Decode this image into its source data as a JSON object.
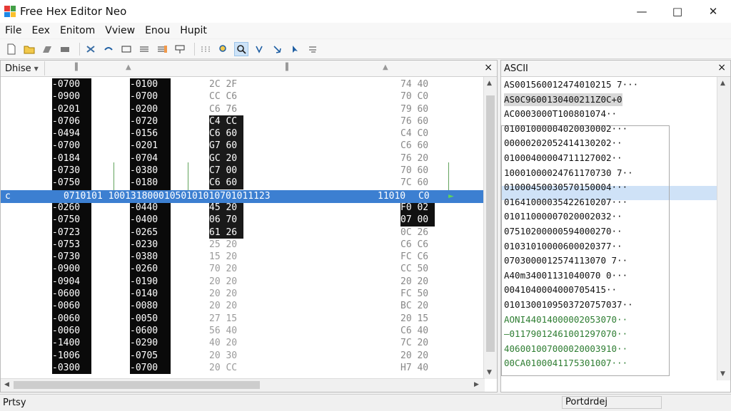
{
  "window": {
    "title": "Free Hex Editor Neo",
    "minimize": "—",
    "maximize": "□",
    "close": "✕"
  },
  "menu": [
    "File",
    "Eex",
    "Enitom",
    "Vview",
    "Enou",
    "Hupit"
  ],
  "toolbar_icons": [
    "new-file-icon",
    "open-folder-icon",
    "save-icon",
    "print-icon",
    "cut-icon",
    "undo-icon",
    "copy-icon",
    "paste-icon",
    "replace-icon",
    "edit-icon",
    "find-icon",
    "zoom-icon",
    "search-icon",
    "filter-icon",
    "bookmark-icon",
    "cursor-icon",
    "settings-icon"
  ],
  "left_pane": {
    "dropdown": "Dhise",
    "close": "×",
    "col_a": [
      "-0700",
      "-0900",
      "-0201",
      "-0706",
      "-0494",
      "-0700",
      "-0184",
      "-0730",
      "-0750",
      "C",
      "-0260",
      "-0750",
      "-0723",
      "-0753",
      "-0730",
      "-0900",
      "-0904",
      "-0600",
      "-0060",
      "-0060",
      "-0060",
      "-1400",
      "-1006",
      "-0300"
    ],
    "col_b": [
      "-0100",
      "-0700",
      "-0200",
      "-0720",
      "-0156",
      "-0201",
      "-0704",
      "-0380",
      "-0180",
      "",
      "-0440",
      "-0400",
      "-0265",
      "-0230",
      "-0380",
      "-0260",
      "-0190",
      "-0140",
      "-0080",
      "-0050",
      "-0600",
      "-0290",
      "-0705",
      "-0700"
    ],
    "col_c": [
      "2C 2F",
      "CC C6",
      "C6 76",
      "C4 CC",
      "C6 60",
      "G7 60",
      "GC 20",
      "C7 00",
      "C6 60",
      "",
      "45 20",
      "06 70",
      "61 26",
      "25 20",
      "15 20",
      "70 20",
      "20 20",
      "20 20",
      "20 20",
      "27 15",
      "56 40",
      "40 20",
      "20 30",
      "20 CC"
    ],
    "col_d": [
      "74 40",
      "70 C0",
      "79 60",
      "76 60",
      "C4 C0",
      "C6 60",
      "76 20",
      "70 60",
      "7C 60",
      "",
      "F0 02",
      "07 00",
      "0C 26",
      "C6 C6",
      "FC C6",
      "CC 50",
      "20 20",
      "FC 50",
      "BC 20",
      "20 15",
      "C6 40",
      "7C 20",
      "20 20",
      "H7 40"
    ],
    "selected_row": {
      "prefix": "c",
      "data": "0710101 10013180001050101010701011123",
      "tail": "11010",
      "tail2": "C0"
    }
  },
  "right_pane": {
    "title": "ASCII",
    "close": "×",
    "rows": [
      "AS001560012474010215 7···",
      "AS0C9600130400211Z0C+0",
      "AC0003000T100801074··",
      "01001000004020030002···",
      "00000202052414130202··",
      "01000400004711127002··",
      "10001000024761170730 7··",
      "01000450030570150004···",
      "01641000035422610207···",
      "01011000007020002032··",
      "07510200000594000270··",
      "01031010000600020377··",
      "0703000012574113070 7··",
      "A40m34001131040070 0···",
      "0041040004000705415··",
      "0101300109503720757037··",
      "AONI44014000002053070··",
      "—01179012461001297070··",
      "406001007000020003910··",
      "00CA0100041175301007···"
    ]
  },
  "status": {
    "left": "Prtsy",
    "right": "Portdrdej"
  }
}
